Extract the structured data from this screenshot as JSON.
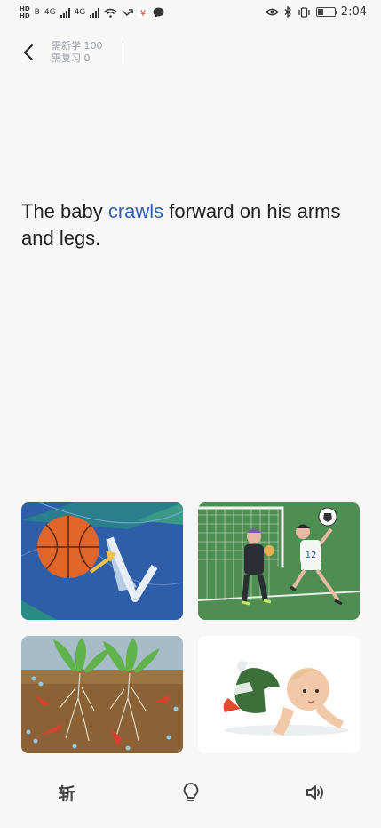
{
  "status_bar": {
    "network_labels": [
      "HD",
      "B",
      "4G",
      "HD",
      "B",
      "4G"
    ],
    "time": "2:04"
  },
  "header": {
    "to_learn": "需新学 100",
    "to_review": "需复习 0"
  },
  "sentence": {
    "before": "The baby ",
    "highlight": "crawls",
    "after": " forward on his arms and legs.",
    "highlight_color": "#2f5fb3"
  },
  "choices": [
    {
      "icon": "basketball-bounce-image"
    },
    {
      "icon": "soccer-goalkeeper-image"
    },
    {
      "icon": "plant-roots-image"
    },
    {
      "icon": "crawling-baby-image"
    }
  ],
  "toolbar": {
    "cut_label": "斩",
    "hint_icon": "lightbulb-icon",
    "sound_icon": "speaker-icon"
  }
}
